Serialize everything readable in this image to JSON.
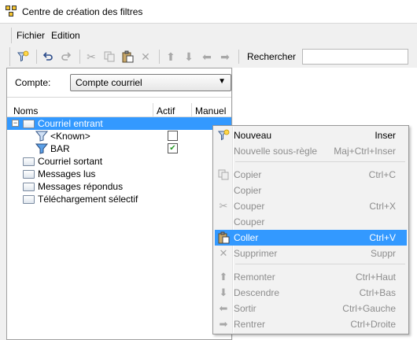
{
  "window": {
    "title": "Centre de création des filtres"
  },
  "menubar": {
    "items": [
      "Fichier",
      "Edition"
    ]
  },
  "toolbar": {
    "search_label": "Rechercher",
    "search_value": "",
    "icons": [
      "new-filter-icon",
      "undo-icon",
      "redo-icon",
      "cut-icon",
      "copy-icon",
      "paste-icon",
      "delete-icon",
      "move-up-icon",
      "move-down-icon",
      "move-left-icon",
      "move-right-icon"
    ]
  },
  "account": {
    "label": "Compte:",
    "selected": "Compte courriel"
  },
  "tree": {
    "columns": {
      "name": "Noms",
      "active": "Actif",
      "manual": "Manuel"
    },
    "rows": [
      {
        "label": "Courriel entrant",
        "type": "folder",
        "expanded": true,
        "selected": true
      },
      {
        "label": "<Known>",
        "type": "filter",
        "active": false
      },
      {
        "label": "BAR",
        "type": "filter",
        "active": true
      },
      {
        "label": "Courriel sortant",
        "type": "folder"
      },
      {
        "label": "Messages lus",
        "type": "folder"
      },
      {
        "label": "Messages répondus",
        "type": "folder"
      },
      {
        "label": "Téléchargement sélectif",
        "type": "folder"
      }
    ]
  },
  "context_menu": {
    "items": [
      {
        "label": "Nouveau",
        "shortcut": "Inser",
        "enabled": true,
        "icon": "new-filter-icon"
      },
      {
        "label": "Nouvelle sous-règle",
        "shortcut": "Maj+Ctrl+Inser",
        "enabled": false
      },
      {
        "label": "Copier",
        "shortcut": "Ctrl+C",
        "enabled": false,
        "icon": "copy-icon"
      },
      {
        "label": "Copier",
        "shortcut": "",
        "enabled": false
      },
      {
        "label": "Couper",
        "shortcut": "Ctrl+X",
        "enabled": false,
        "icon": "cut-icon"
      },
      {
        "label": "Couper",
        "shortcut": "",
        "enabled": false
      },
      {
        "label": "Coller",
        "shortcut": "Ctrl+V",
        "enabled": true,
        "highlighted": true,
        "icon": "paste-icon"
      },
      {
        "label": "Supprimer",
        "shortcut": "Suppr",
        "enabled": false,
        "icon": "delete-icon"
      },
      {
        "label": "Remonter",
        "shortcut": "Ctrl+Haut",
        "enabled": false,
        "icon": "move-up-icon"
      },
      {
        "label": "Descendre",
        "shortcut": "Ctrl+Bas",
        "enabled": false,
        "icon": "move-down-icon"
      },
      {
        "label": "Sortir",
        "shortcut": "Ctrl+Gauche",
        "enabled": false,
        "icon": "move-left-icon"
      },
      {
        "label": "Rentrer",
        "shortcut": "Ctrl+Droite",
        "enabled": false,
        "icon": "move-right-icon"
      }
    ]
  },
  "colors": {
    "selection": "#3399ff",
    "disabled_text": "#8d8d8d",
    "check_green": "#2a9a2a"
  }
}
